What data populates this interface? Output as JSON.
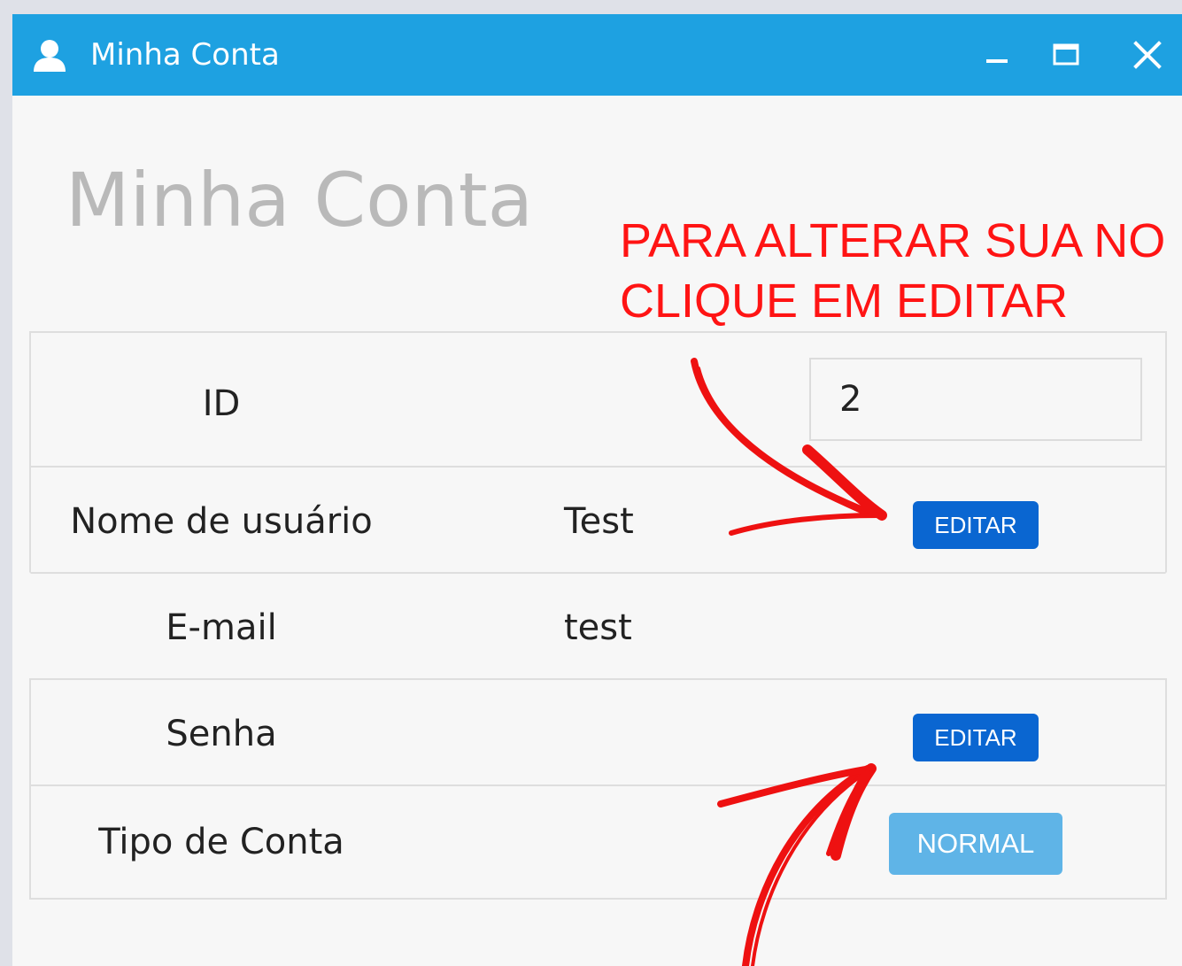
{
  "window": {
    "title": "Minha Conta",
    "icon": "user-icon",
    "controls": [
      "minimize-icon",
      "maximize-icon",
      "close-icon"
    ],
    "title_bar_color": "#1ea1e1"
  },
  "page": {
    "heading": "Minha Conta"
  },
  "annotation": {
    "line1": "PARA ALTERAR SUA NO",
    "line2": "CLIQUE EM EDITAR",
    "color": "#ff1414"
  },
  "fields": {
    "id": {
      "label": "ID",
      "value": "2"
    },
    "username": {
      "label": "Nome de usuário",
      "value": "Test",
      "button": "EDITAR"
    },
    "email": {
      "label": "E-mail",
      "value": "test"
    },
    "password": {
      "label": "Senha",
      "button": "EDITAR"
    },
    "account_type": {
      "label": "Tipo de Conta",
      "button": "NORMAL"
    }
  },
  "colors": {
    "edit_button": "#0a66d1",
    "normal_button": "#5fb4e7"
  }
}
